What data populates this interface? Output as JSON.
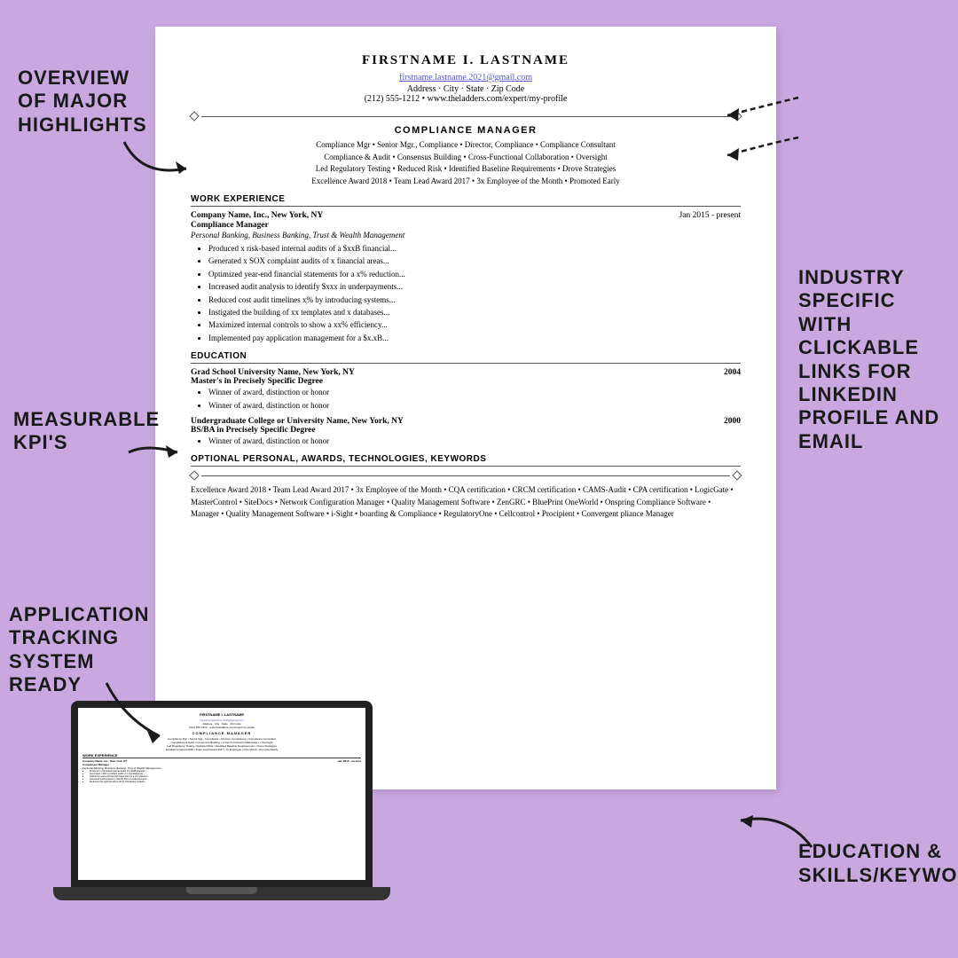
{
  "background_color": "#c9a8e0",
  "annotations": {
    "overview": "OVERVIEW OF MAJOR HIGHLIGHTS",
    "measurable": "MEASURABLE KPI'S",
    "application": "APPLICATION TRACKING SYSTEM READY",
    "industry": "INDUSTRY SPECIFIC WITH CLICKABLE LINKS FOR LINKEDIN PROFILE AND EMAIL",
    "education": "EDUCATION & SKILLS/KEYWORDS"
  },
  "resume": {
    "name": "FIRSTNAME I. LASTNAME",
    "email": "firstname.lastname.2021@gmail.com",
    "address": "Address · City · State · Zip Code",
    "phone_web": "(212) 555-1212 • www.theladders.com/expert/my-profile",
    "title": "COMPLIANCE MANAGER",
    "keywords_line1": "Compliance Mgr • Senior Mgr., Compliance • Director, Compliance • Compliance Consultant",
    "keywords_line2": "Compliance & Audit • Consensus Building • Cross-Functional Collaboration • Oversight",
    "keywords_line3": "Led Regulatory Testing • Reduced Risk • Identified Baseline Requirements • Drove Strategies",
    "keywords_line4": "Excellence Award 2018 • Team Lead Award 2017 • 3x Employee of the Month • Promoted Early",
    "work_experience_header": "WORK EXPERIENCE",
    "job1": {
      "company": "Company Name, Inc., New York, NY",
      "date": "Jan 2015 - present",
      "title": "Compliance Manager",
      "subtitle": "Personal Banking, Business Banking, Trust & Wealth Management",
      "bullets": [
        "Produced x risk-based internal audits of a $xxB financial...",
        "Generated x SOX complaint audits of x financial areas...",
        "Optimized year-end financial statements for a x% reduction...",
        "Increased audit analysis to identify $xxx in underpayments...",
        "Reduced cost audit timelines x% by introducing systems...",
        "Instigated the building of xx templates and x databases...",
        "Maximized internal controls to show a xx% efficiency...",
        "Implemented pay application management for a $x.xB..."
      ]
    },
    "education_header": "EDUCATION",
    "edu1": {
      "school": "Grad School University Name, New York, NY",
      "year": "2004",
      "degree": "Master's in Precisely Specific Degree",
      "bullets": [
        "Winner of award, distinction or honor",
        "Winner of award, distinction or honor"
      ]
    },
    "edu2": {
      "school": "Undergraduate College or University Name, New York, NY",
      "year": "2000",
      "degree": "BS/BA in Precisely Specific Degree",
      "bullets": [
        "Winner of award, distinction or honor"
      ]
    },
    "optional_header": "OPTIONAL PERSONAL, AWARDS, TECHNOLOGIES, KEYWORDS",
    "optional_text": "Excellence Award 2018 • Team Lead Award 2017 • 3x Employee of the Month • CQA certification • CRCM certification • CAMS-Audit • CPA certification • LogicGate • MasterControl • SiteDocs • Network Configuration Manager • Quality Management Software • ZenGRC • BluePrint OneWorld • Onspring Compliance Software • Manager • Quality Management Software • i-Sight • boarding & Compliance • RegulatoryOne • Cellcontrol • Procipient • Convergent pliance Manager"
  }
}
